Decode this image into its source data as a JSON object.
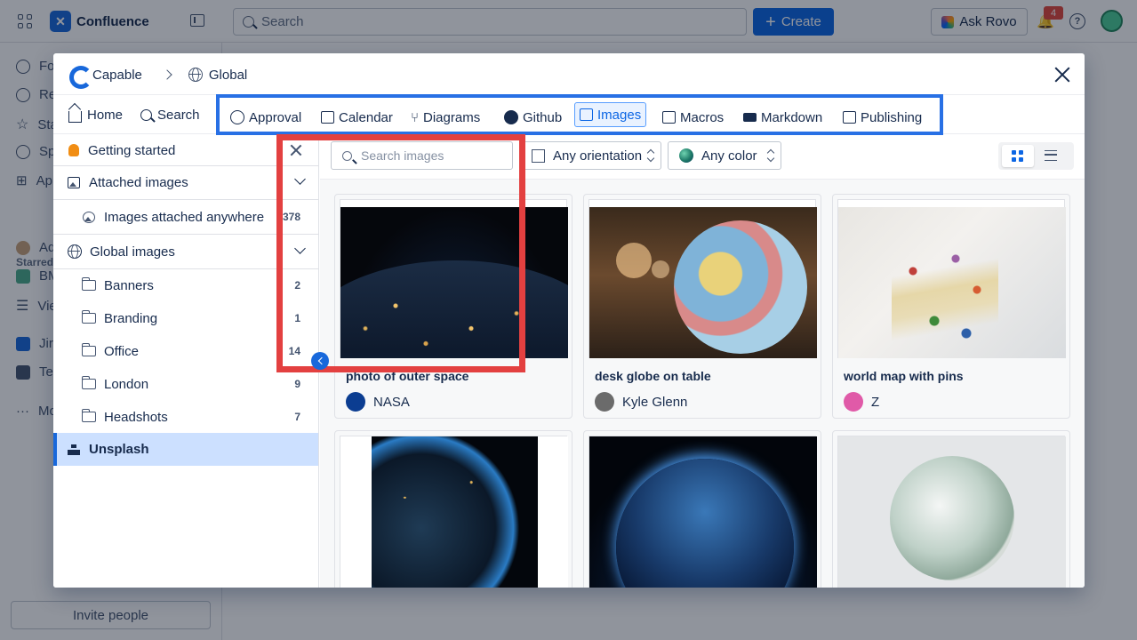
{
  "app": {
    "name": "Confluence",
    "search_placeholder": "Search",
    "create_label": "Create",
    "rovo_label": "Ask Rovo",
    "notification_count": "4",
    "help_label": "?"
  },
  "left_nav": {
    "items": [
      {
        "label": "Fo",
        "icon": "person-icon"
      },
      {
        "label": "Re",
        "icon": "clock-icon"
      },
      {
        "label": "Sta",
        "icon": "star-icon"
      },
      {
        "label": "Sp",
        "icon": "spaces-icon"
      },
      {
        "label": "Ap",
        "icon": "apps-icon"
      }
    ],
    "starred_heading": "Starred",
    "starred_items": [
      {
        "label": "Ad"
      },
      {
        "label": "BM"
      },
      {
        "label": "Vie"
      },
      {
        "label": "Jir"
      },
      {
        "label": "Te"
      },
      {
        "label": "Mo"
      }
    ],
    "invite_label": "Invite people"
  },
  "modal": {
    "breadcrumb": {
      "app": "Capable",
      "scope": "Global"
    },
    "toolbar": {
      "home": "Home",
      "search": "Search"
    },
    "plugins": [
      {
        "label": "Approval",
        "icon": "check-circle-icon"
      },
      {
        "label": "Calendar",
        "icon": "calendar-icon"
      },
      {
        "label": "Diagrams",
        "icon": "diagram-icon"
      },
      {
        "label": "Github",
        "icon": "github-icon"
      },
      {
        "label": "Images",
        "icon": "image-icon",
        "active": true
      },
      {
        "label": "Macros",
        "icon": "macros-icon"
      },
      {
        "label": "Markdown",
        "icon": "markdown-icon"
      },
      {
        "label": "Publishing",
        "icon": "publish-icon"
      }
    ],
    "sidebar": {
      "getting_started": "Getting started",
      "attached_heading": "Attached images",
      "attached_anywhere": {
        "label": "Images attached anywhere",
        "count": "378"
      },
      "global_heading": "Global images",
      "folders": [
        {
          "label": "Banners",
          "count": "2"
        },
        {
          "label": "Branding",
          "count": "1"
        },
        {
          "label": "Office",
          "count": "14"
        },
        {
          "label": "London",
          "count": "9"
        },
        {
          "label": "Headshots",
          "count": "7"
        }
      ],
      "unsplash": "Unsplash"
    },
    "filters": {
      "search_placeholder": "Search images",
      "orientation": "Any orientation",
      "color": "Any color"
    },
    "images": [
      {
        "title": "photo of outer space",
        "author": "NASA",
        "author_color": "#0b3d91"
      },
      {
        "title": "desk globe on table",
        "author": "Kyle Glenn",
        "author_color": "#6b6b6b"
      },
      {
        "title": "world map with pins",
        "author": "Z",
        "author_color": "#e05aa8"
      },
      {
        "title": "",
        "author": ""
      },
      {
        "title": "",
        "author": ""
      },
      {
        "title": "",
        "author": ""
      }
    ]
  },
  "colors": {
    "primary": "#0c66e4",
    "plugin_frame": "#2870e5",
    "highlight": "#e34040",
    "selected_bg": "#cce0ff"
  }
}
